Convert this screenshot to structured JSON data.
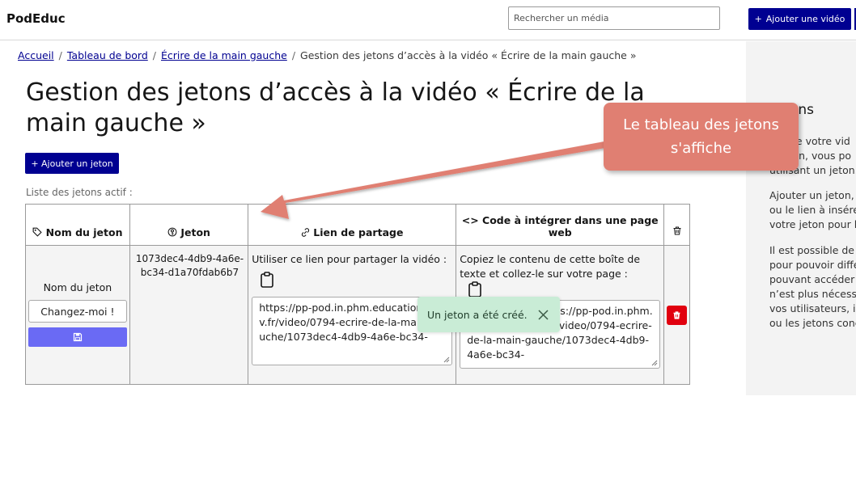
{
  "header": {
    "logo": "PodEduc",
    "search_placeholder": "Rechercher un média",
    "add_video_label": "Ajouter une vidéo"
  },
  "breadcrumb": {
    "items": [
      "Accueil",
      "Tableau de bord",
      "Écrire de la main gauche"
    ],
    "current": "Gestion des jetons d’accès à la vidéo « Écrire de la main gauche »"
  },
  "page": {
    "title": "Gestion des jetons d’accès à la vidéo « Écrire de la main gauche »",
    "add_token_label": "+ Ajouter un jeton",
    "list_label": "Liste des jetons actif :"
  },
  "table": {
    "headers": {
      "name": "Nom du jeton",
      "token": "Jeton",
      "link": "Lien de partage",
      "embed": "Code à intégrer dans une page web"
    },
    "row": {
      "name_label": "Nom du jeton",
      "name_value": "Changez-moi !",
      "token": "1073dec4-4db9-4a6e-bc34-d1a70fdab6b7",
      "link_instruction": "Utiliser ce lien pour partager la vidéo :",
      "link_url": "https://pp-pod.in.phm.education.gouv.fr/video/0794-ecrire-de-la-main-gauche/1073dec4-4db9-4a6e-bc34-",
      "embed_instruction": "Copiez le contenu de cette boîte de texte et collez-le sur votre page :",
      "embed_code": "<iframe src=\"https://pp-pod.in.phm.education.gouv.fr/video/0794-ecrire-de-la-main-gauche/1073dec4-4db9-4a6e-bc34-"
    }
  },
  "toast": {
    "message": "Un jeton a été créé."
  },
  "sidebar": {
    "title": "ons",
    "p1": [
      "ue votre vid",
      "lon, vous po",
      "utilisant un jeton."
    ],
    "p2": [
      "Ajouter un jeton,",
      "ou le lien à insére",
      "votre jeton pour l"
    ],
    "p3": [
      "Il est possible de",
      "pour pouvoir diffé",
      "pouvant accéder",
      "n’est plus nécessa",
      "vos utilisateurs, il",
      "ou les jetons conc"
    ]
  },
  "callout": {
    "text": "Le tableau des jetons s'affiche"
  },
  "colors": {
    "primary": "#000091",
    "save": "#6a6af4",
    "delete": "#e1000f",
    "toast": "#c9ecd6",
    "callout": "#e07f72"
  },
  "icons": {
    "name_header": "tag-icon",
    "token_header": "key-icon",
    "link_header": "link-icon",
    "embed_header": "code-icon",
    "delete_header": "trash-icon",
    "save": "floppy-disk-icon",
    "copy": "clipboard-icon",
    "toast_close": "close-icon"
  }
}
